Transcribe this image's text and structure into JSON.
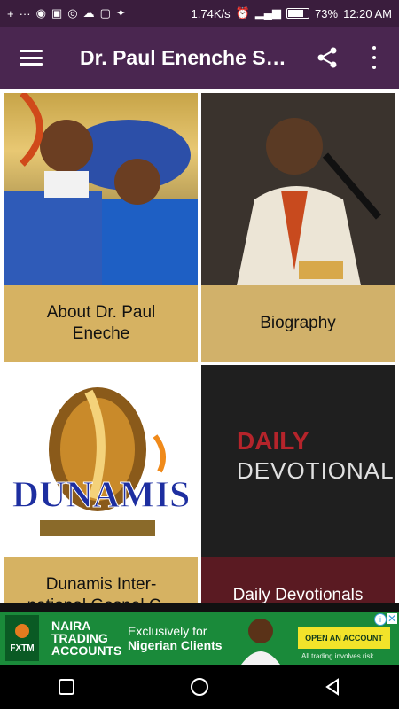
{
  "status_bar": {
    "left_icons": [
      "plus-icon",
      "more-dots-icon",
      "messenger-icon",
      "photo-icon",
      "whatsapp-icon",
      "cloud-icon",
      "instagram-icon",
      "twitter-icon"
    ],
    "network_speed": "1.74K/s",
    "battery": "73%",
    "time": "12:20 AM"
  },
  "app_bar": {
    "title": "Dr. Paul Enenche Se..."
  },
  "tiles": [
    {
      "label": "About Dr. Paul Eneche"
    },
    {
      "label": "Biography"
    },
    {
      "label": "Dunamis Inter-national Gospel C..."
    },
    {
      "label": "Daily Devotionals"
    }
  ],
  "tile_images": {
    "dunamis_text": "DUNAMIS",
    "daily_text": "DAILY",
    "devotional_text": "DEVOTIONAL"
  },
  "ad": {
    "brand": "FXTM",
    "headline_1": "NAIRA",
    "headline_2": "TRADING",
    "headline_3": "ACCOUNTS",
    "copy_1": "Exclusively for",
    "copy_2": "Nigerian Clients",
    "cta": "OPEN AN ACCOUNT",
    "risk": "All trading involves risk."
  },
  "colors": {
    "app_bar": "#4a2650",
    "status_bar": "#3a1d3d",
    "tile_gold": "#d6b262",
    "tile_maroon": "#5a1a22",
    "ad_green": "#1a8a3a"
  }
}
